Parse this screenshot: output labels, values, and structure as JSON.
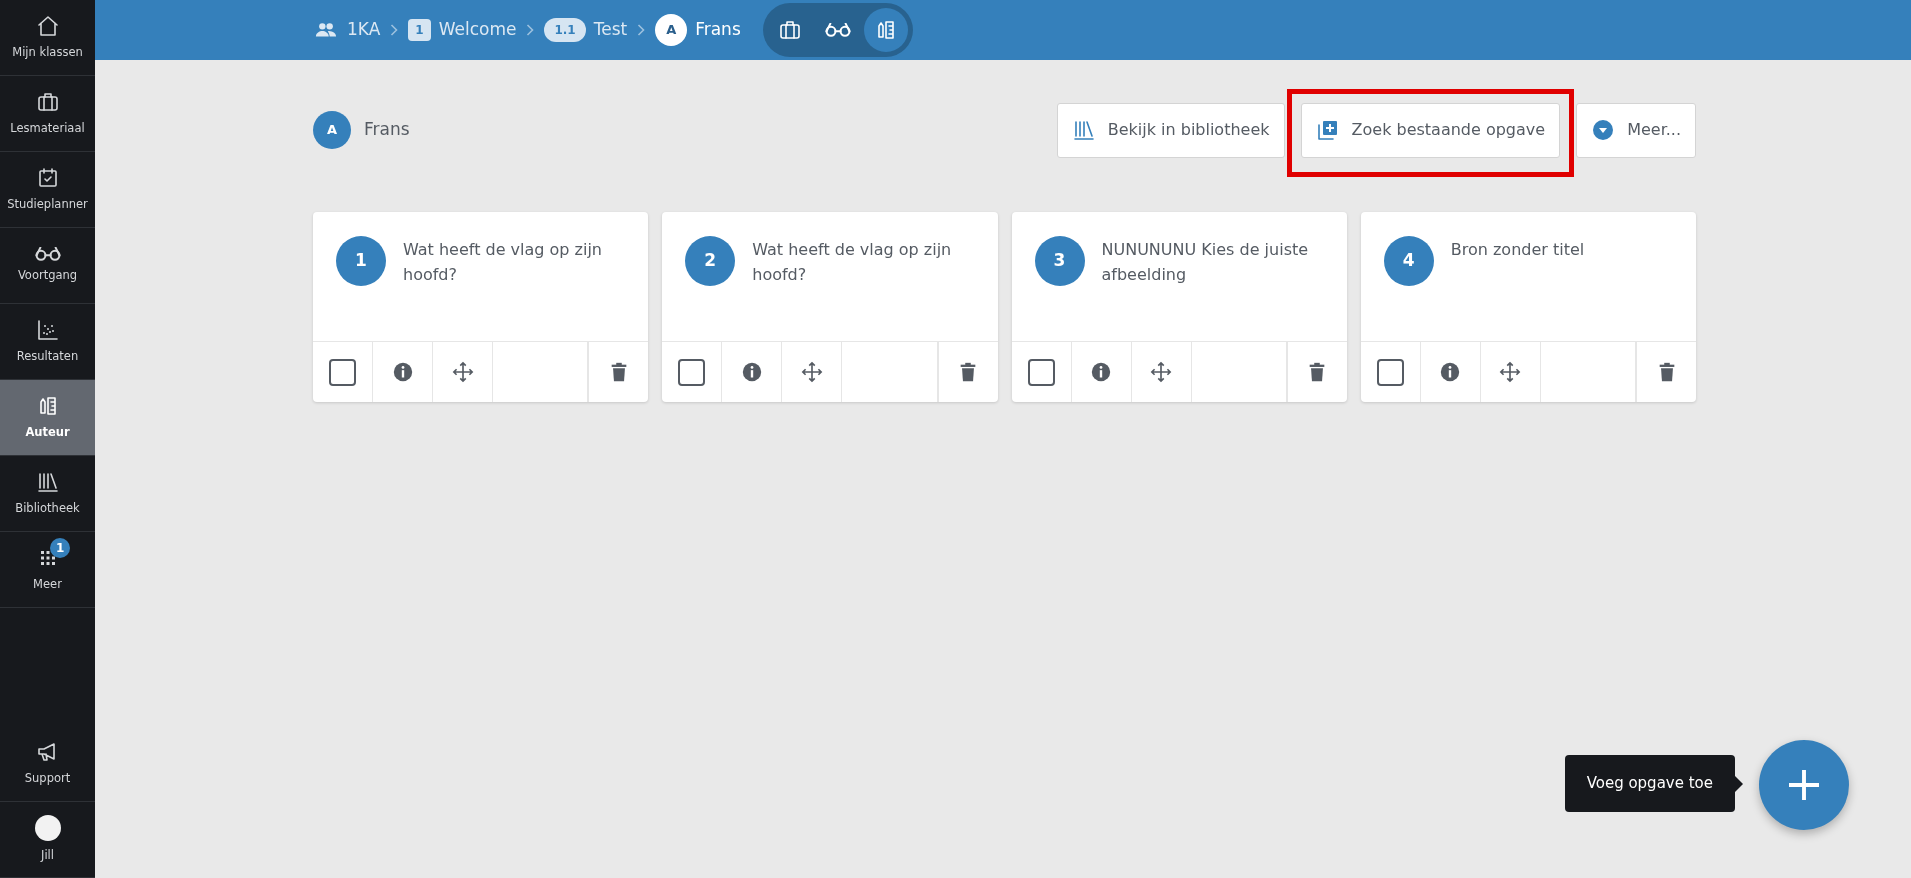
{
  "sidebar": {
    "items": [
      {
        "label": "Mijn klassen",
        "selected": false
      },
      {
        "label": "Lesmateriaal",
        "selected": false
      },
      {
        "label": "Studieplanner",
        "selected": false
      },
      {
        "label": "Voortgang",
        "selected": false
      },
      {
        "label": "Resultaten",
        "selected": false
      },
      {
        "label": "Auteur",
        "selected": true
      },
      {
        "label": "Bibliotheek",
        "selected": false
      },
      {
        "label": "Meer",
        "selected": false,
        "badge": "1"
      }
    ],
    "footer": [
      {
        "label": "Support"
      },
      {
        "label": "Jill"
      }
    ]
  },
  "breadcrumb": [
    {
      "kind": "group",
      "label": "1KA"
    },
    {
      "kind": "numbered",
      "number": "1",
      "label": "Welcome"
    },
    {
      "kind": "pill",
      "number": "1.1",
      "label": "Test"
    },
    {
      "kind": "avatar",
      "number": "A",
      "label": "Frans"
    }
  ],
  "modes": [
    {
      "selected": false
    },
    {
      "selected": false
    },
    {
      "selected": true
    }
  ],
  "header": {
    "avatar": "A",
    "title": "Frans"
  },
  "actions": [
    {
      "label": "Bekijk in bibliotheek",
      "highlighted": false
    },
    {
      "label": "Zoek bestaande opgave",
      "highlighted": true
    },
    {
      "label": "Meer...",
      "highlighted": false
    }
  ],
  "cards": [
    {
      "number": "1",
      "title": "Wat heeft de vlag op zijn hoofd?",
      "checked": false
    },
    {
      "number": "2",
      "title": "Wat heeft de vlag op zijn hoofd?",
      "checked": false
    },
    {
      "number": "3",
      "title": "NUNUNUNU Kies de juiste afbeelding",
      "checked": false
    },
    {
      "number": "4",
      "title": "Bron zonder titel",
      "checked": false
    }
  ],
  "fab": {
    "tooltip": "Voeg opgave toe"
  }
}
